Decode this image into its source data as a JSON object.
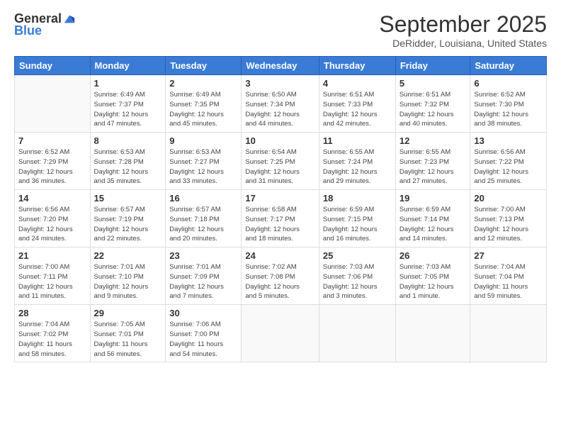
{
  "header": {
    "logo_general": "General",
    "logo_blue": "Blue",
    "title": "September 2025",
    "location": "DeRidder, Louisiana, United States"
  },
  "days_of_week": [
    "Sunday",
    "Monday",
    "Tuesday",
    "Wednesday",
    "Thursday",
    "Friday",
    "Saturday"
  ],
  "weeks": [
    [
      {
        "day": "",
        "info": ""
      },
      {
        "day": "1",
        "info": "Sunrise: 6:49 AM\nSunset: 7:37 PM\nDaylight: 12 hours\nand 47 minutes."
      },
      {
        "day": "2",
        "info": "Sunrise: 6:49 AM\nSunset: 7:35 PM\nDaylight: 12 hours\nand 45 minutes."
      },
      {
        "day": "3",
        "info": "Sunrise: 6:50 AM\nSunset: 7:34 PM\nDaylight: 12 hours\nand 44 minutes."
      },
      {
        "day": "4",
        "info": "Sunrise: 6:51 AM\nSunset: 7:33 PM\nDaylight: 12 hours\nand 42 minutes."
      },
      {
        "day": "5",
        "info": "Sunrise: 6:51 AM\nSunset: 7:32 PM\nDaylight: 12 hours\nand 40 minutes."
      },
      {
        "day": "6",
        "info": "Sunrise: 6:52 AM\nSunset: 7:30 PM\nDaylight: 12 hours\nand 38 minutes."
      }
    ],
    [
      {
        "day": "7",
        "info": "Sunrise: 6:52 AM\nSunset: 7:29 PM\nDaylight: 12 hours\nand 36 minutes."
      },
      {
        "day": "8",
        "info": "Sunrise: 6:53 AM\nSunset: 7:28 PM\nDaylight: 12 hours\nand 35 minutes."
      },
      {
        "day": "9",
        "info": "Sunrise: 6:53 AM\nSunset: 7:27 PM\nDaylight: 12 hours\nand 33 minutes."
      },
      {
        "day": "10",
        "info": "Sunrise: 6:54 AM\nSunset: 7:25 PM\nDaylight: 12 hours\nand 31 minutes."
      },
      {
        "day": "11",
        "info": "Sunrise: 6:55 AM\nSunset: 7:24 PM\nDaylight: 12 hours\nand 29 minutes."
      },
      {
        "day": "12",
        "info": "Sunrise: 6:55 AM\nSunset: 7:23 PM\nDaylight: 12 hours\nand 27 minutes."
      },
      {
        "day": "13",
        "info": "Sunrise: 6:56 AM\nSunset: 7:22 PM\nDaylight: 12 hours\nand 25 minutes."
      }
    ],
    [
      {
        "day": "14",
        "info": "Sunrise: 6:56 AM\nSunset: 7:20 PM\nDaylight: 12 hours\nand 24 minutes."
      },
      {
        "day": "15",
        "info": "Sunrise: 6:57 AM\nSunset: 7:19 PM\nDaylight: 12 hours\nand 22 minutes."
      },
      {
        "day": "16",
        "info": "Sunrise: 6:57 AM\nSunset: 7:18 PM\nDaylight: 12 hours\nand 20 minutes."
      },
      {
        "day": "17",
        "info": "Sunrise: 6:58 AM\nSunset: 7:17 PM\nDaylight: 12 hours\nand 18 minutes."
      },
      {
        "day": "18",
        "info": "Sunrise: 6:59 AM\nSunset: 7:15 PM\nDaylight: 12 hours\nand 16 minutes."
      },
      {
        "day": "19",
        "info": "Sunrise: 6:59 AM\nSunset: 7:14 PM\nDaylight: 12 hours\nand 14 minutes."
      },
      {
        "day": "20",
        "info": "Sunrise: 7:00 AM\nSunset: 7:13 PM\nDaylight: 12 hours\nand 12 minutes."
      }
    ],
    [
      {
        "day": "21",
        "info": "Sunrise: 7:00 AM\nSunset: 7:11 PM\nDaylight: 12 hours\nand 11 minutes."
      },
      {
        "day": "22",
        "info": "Sunrise: 7:01 AM\nSunset: 7:10 PM\nDaylight: 12 hours\nand 9 minutes."
      },
      {
        "day": "23",
        "info": "Sunrise: 7:01 AM\nSunset: 7:09 PM\nDaylight: 12 hours\nand 7 minutes."
      },
      {
        "day": "24",
        "info": "Sunrise: 7:02 AM\nSunset: 7:08 PM\nDaylight: 12 hours\nand 5 minutes."
      },
      {
        "day": "25",
        "info": "Sunrise: 7:03 AM\nSunset: 7:06 PM\nDaylight: 12 hours\nand 3 minutes."
      },
      {
        "day": "26",
        "info": "Sunrise: 7:03 AM\nSunset: 7:05 PM\nDaylight: 12 hours\nand 1 minute."
      },
      {
        "day": "27",
        "info": "Sunrise: 7:04 AM\nSunset: 7:04 PM\nDaylight: 11 hours\nand 59 minutes."
      }
    ],
    [
      {
        "day": "28",
        "info": "Sunrise: 7:04 AM\nSunset: 7:02 PM\nDaylight: 11 hours\nand 58 minutes."
      },
      {
        "day": "29",
        "info": "Sunrise: 7:05 AM\nSunset: 7:01 PM\nDaylight: 11 hours\nand 56 minutes."
      },
      {
        "day": "30",
        "info": "Sunrise: 7:06 AM\nSunset: 7:00 PM\nDaylight: 11 hours\nand 54 minutes."
      },
      {
        "day": "",
        "info": ""
      },
      {
        "day": "",
        "info": ""
      },
      {
        "day": "",
        "info": ""
      },
      {
        "day": "",
        "info": ""
      }
    ]
  ]
}
